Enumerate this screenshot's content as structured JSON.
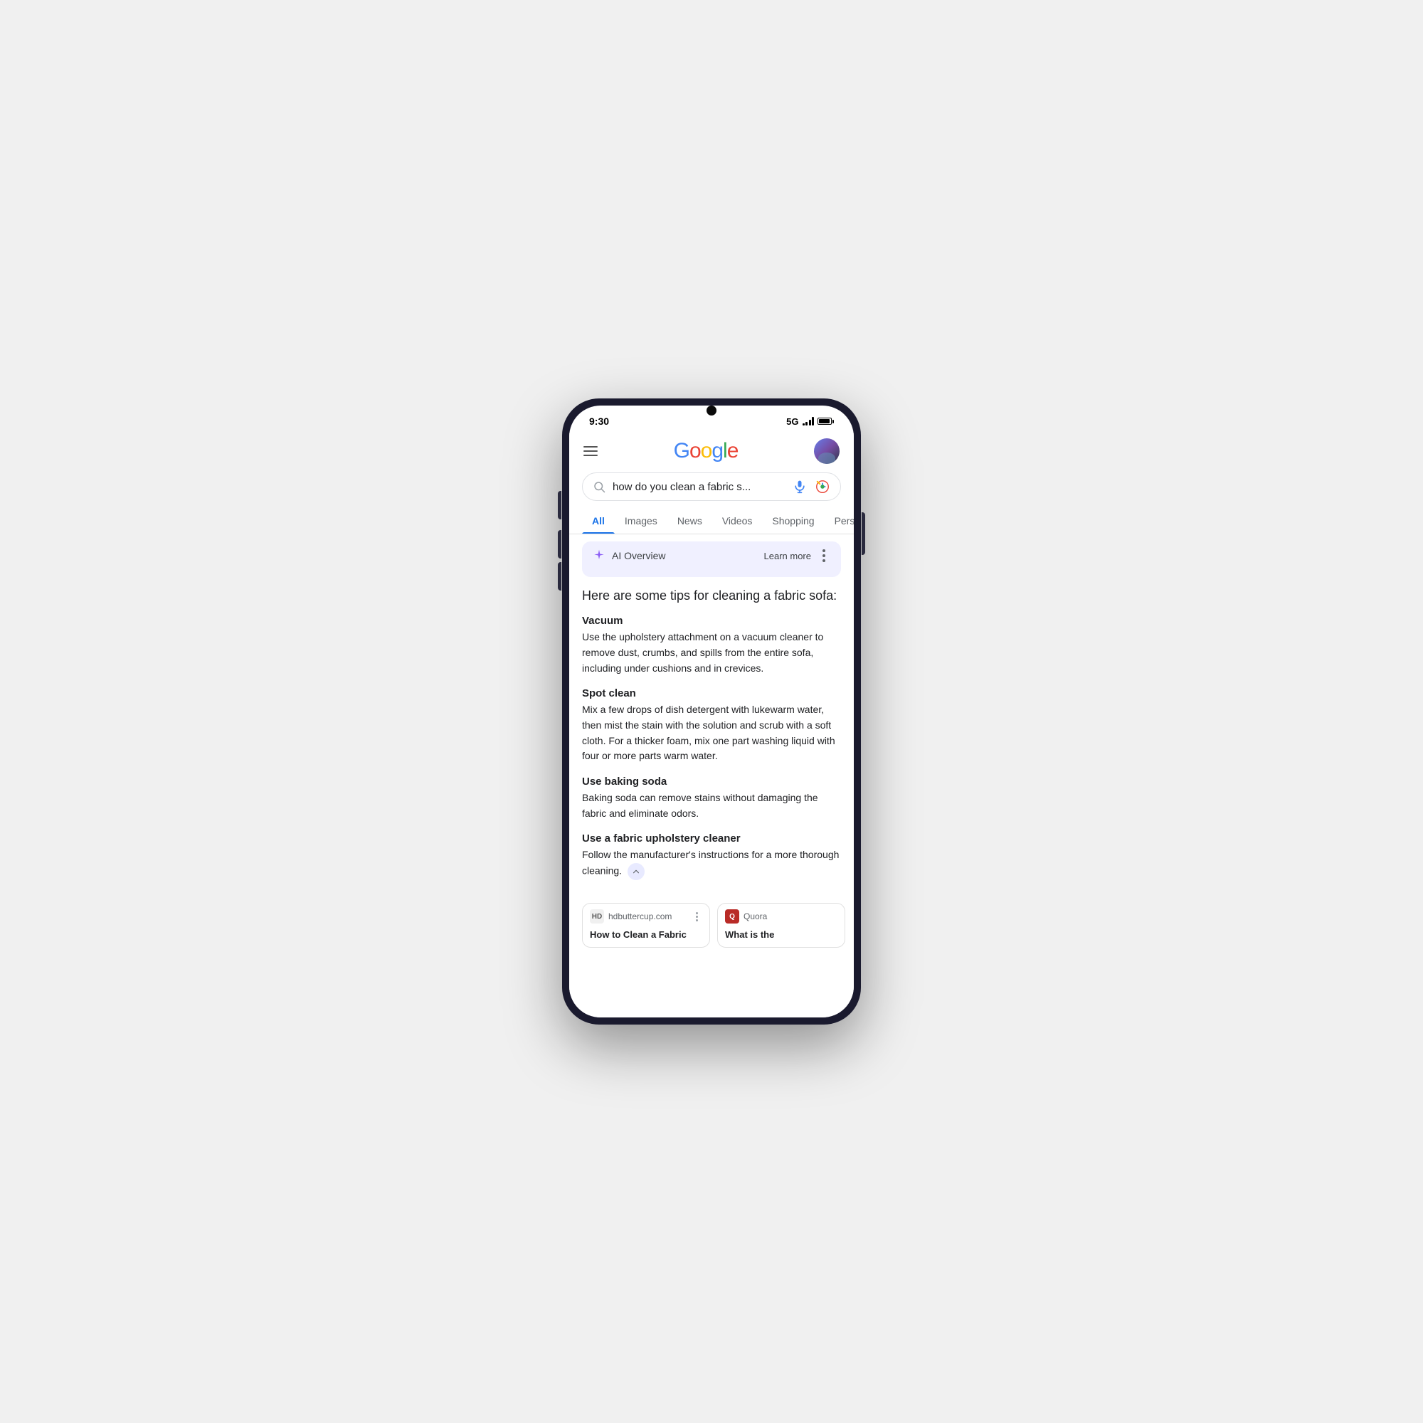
{
  "phone": {
    "status_bar": {
      "time": "9:30",
      "network": "5G"
    }
  },
  "header": {
    "menu_label": "menu",
    "logo_text": "Google",
    "avatar_alt": "user avatar"
  },
  "search": {
    "query": "how do you clean a fabric s...",
    "placeholder": "Search"
  },
  "tabs": [
    {
      "label": "All",
      "active": true
    },
    {
      "label": "Images",
      "active": false
    },
    {
      "label": "News",
      "active": false
    },
    {
      "label": "Videos",
      "active": false
    },
    {
      "label": "Shopping",
      "active": false
    },
    {
      "label": "Pers…",
      "active": false
    }
  ],
  "ai_overview": {
    "title": "AI Overview",
    "learn_more": "Learn more",
    "icon": "spark"
  },
  "content": {
    "heading": "Here are some tips for cleaning a fabric sofa:",
    "tips": [
      {
        "title": "Vacuum",
        "desc": "Use the upholstery attachment on a vacuum cleaner to remove dust, crumbs, and spills from the entire sofa, including under cushions and in crevices."
      },
      {
        "title": "Spot clean",
        "desc": "Mix a few drops of dish detergent with lukewarm water, then mist the stain with the solution and scrub with a soft cloth. For a thicker foam, mix one part washing liquid with four or more parts warm water."
      },
      {
        "title": "Use baking soda",
        "desc": "Baking soda can remove stains without damaging the fabric and eliminate odors."
      },
      {
        "title": "Use a fabric upholstery cleaner",
        "desc": "Follow the manufacturer's instructions for a more thorough cleaning."
      }
    ]
  },
  "sources": [
    {
      "favicon_text": "HD",
      "domain": "hdbuttercup.com",
      "title": "How to Clean a Fabric",
      "type": "hd"
    },
    {
      "favicon_text": "Q",
      "domain": "Quora",
      "title": "What is the",
      "type": "quora"
    }
  ]
}
